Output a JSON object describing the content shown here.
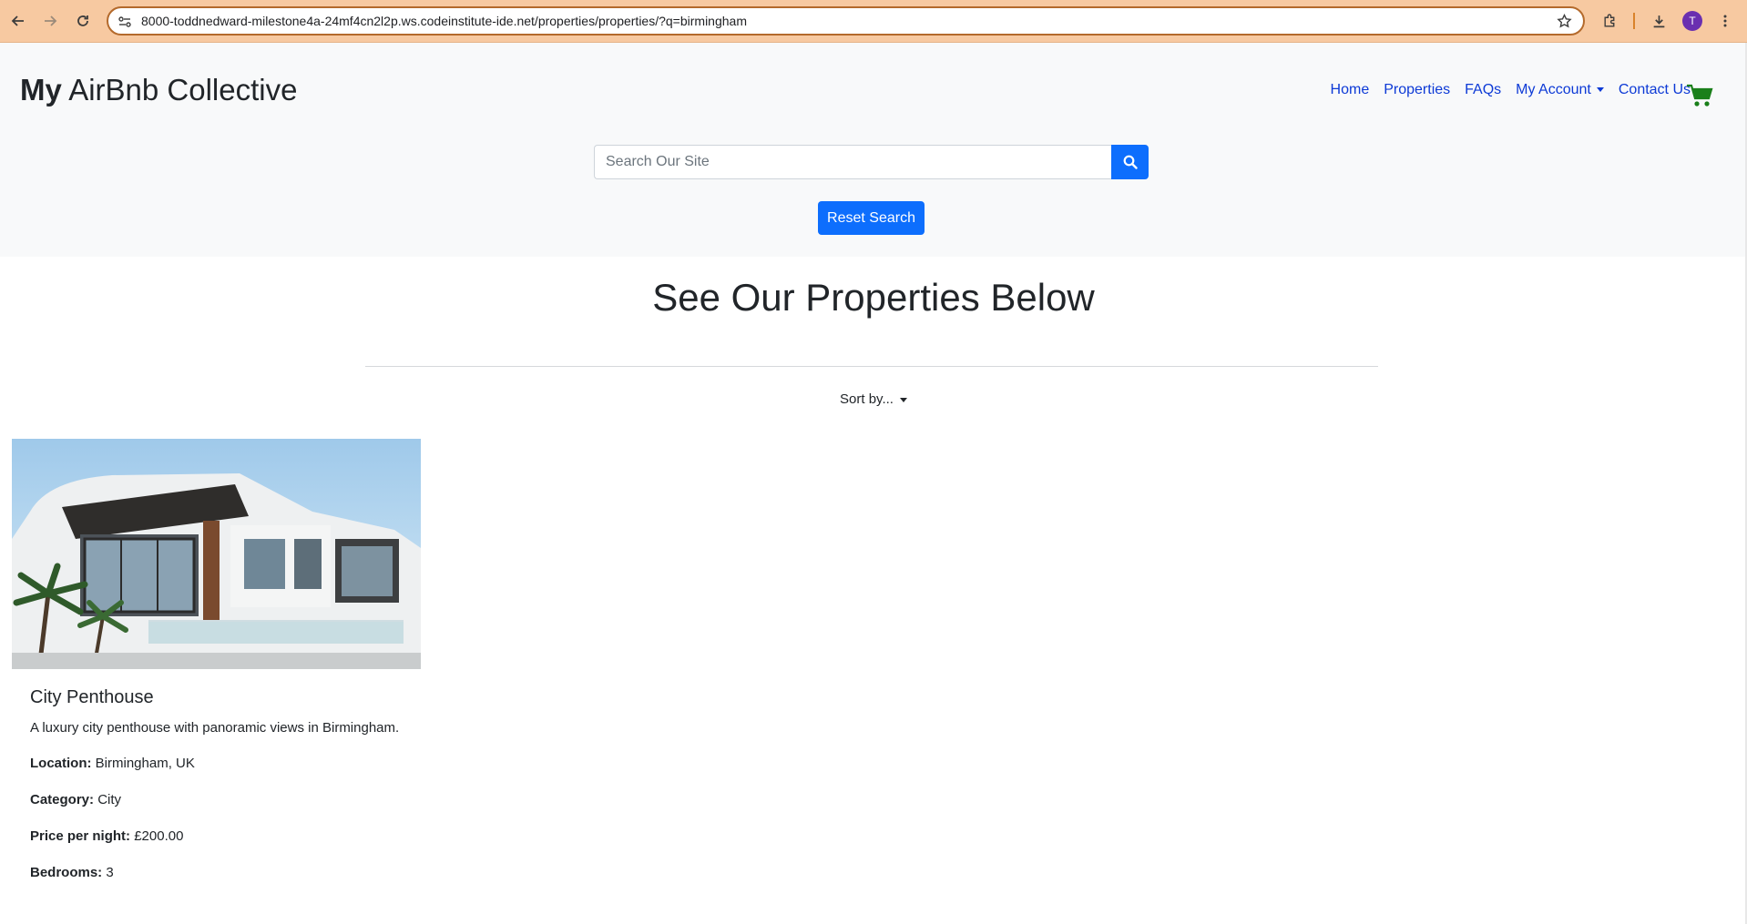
{
  "browser": {
    "url": "8000-toddnedward-milestone4a-24mf4cn2l2p.ws.codeinstitute-ide.net/properties/properties/?q=birmingham",
    "profile_initial": "T"
  },
  "header": {
    "brand_bold": "My",
    "brand_rest": "AirBnb Collective",
    "nav": {
      "home": "Home",
      "properties": "Properties",
      "faqs": "FAQs",
      "account": "My Account",
      "contact": "Contact Us"
    },
    "search": {
      "placeholder": "Search Our Site"
    },
    "reset_label": "Reset Search"
  },
  "main": {
    "title": "See Our Properties Below",
    "sort_label": "Sort by...",
    "properties": [
      {
        "name": "City Penthouse",
        "description": "A luxury city penthouse with panoramic views in Birmingham.",
        "location_label": "Location:",
        "location": "Birmingham, UK",
        "category_label": "Category:",
        "category": "City",
        "price_label": "Price per night:",
        "price": "£200.00",
        "bedrooms_label": "Bedrooms:",
        "bedrooms": "3"
      }
    ]
  },
  "colors": {
    "primary": "#0d6efd",
    "nav_link": "#0d3ad6",
    "cart": "#1a7f1a",
    "header_bg": "#f8f9fa"
  }
}
